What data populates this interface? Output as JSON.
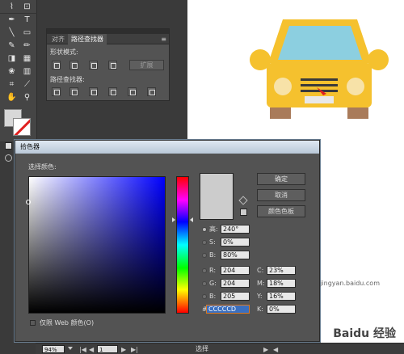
{
  "pathfinder_panel": {
    "tabs": [
      "对齐",
      "路径查找器"
    ],
    "shape_modes_label": "形状模式:",
    "expand_label": "扩展",
    "pathfinders_label": "路径查找器:"
  },
  "color_picker": {
    "title": "拾色器",
    "select_color_label": "选择颜色:",
    "buttons": {
      "ok": "确定",
      "cancel": "取消",
      "swatches": "颜色色板"
    },
    "fields": {
      "H": {
        "label": "高:",
        "value": "240°"
      },
      "S": {
        "label": "S:",
        "value": "0%"
      },
      "B": {
        "label": "B:",
        "value": "80%"
      },
      "R": {
        "label": "R:",
        "value": "204"
      },
      "G": {
        "label": "G:",
        "value": "204"
      },
      "Bl": {
        "label": "B:",
        "value": "205"
      },
      "C": {
        "label": "C:",
        "value": "23%"
      },
      "M": {
        "label": "M:",
        "value": "18%"
      },
      "Y": {
        "label": "Y:",
        "value": "16%"
      },
      "K": {
        "label": "K:",
        "value": "0%"
      },
      "hex": {
        "label": "#",
        "value": "CCCCCD"
      }
    },
    "web_only_label": "仅限 Web 颜色(O)",
    "current_color": "#CCCCCD"
  },
  "status_bar": {
    "zoom": "94%",
    "page": "1",
    "tool": "选择"
  },
  "watermark": {
    "brand": "Baidu 经验",
    "url": "jingyan.baidu.com"
  },
  "colors": {
    "car_body": "#F5C12E",
    "car_window": "#8CCFE0",
    "car_wheel": "#A97B5A",
    "car_light": "#F7E2A8",
    "accent_red": "#E02020"
  }
}
